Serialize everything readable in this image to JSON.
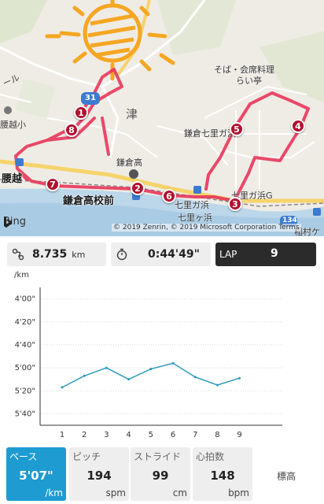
{
  "map": {
    "labels": {
      "sobakaiseki": "そば・会席料理",
      "raitei": "らい亭",
      "tsu": "津",
      "kamakura_high": "鎌倉高",
      "kamakura_shichirigahama": "鎌倉七里ガ浜",
      "shichirigahama_g": "七里ガ浜G",
      "kamakura_koukoumae": "鎌倉高校前",
      "shichirigahama_station": "七里ガ浜",
      "shichirigahama_coast": "七里ヶ浜",
      "inamuragasaki": "稲村ケ",
      "koshigoe": "腰越",
      "koshigoe_school": "腰越小",
      "road_number_31": "31",
      "road_number_134": "134",
      "road_fragment": "ール"
    },
    "markers": [
      "1",
      "8",
      "7",
      "2",
      "6",
      "3",
      "5",
      "4"
    ],
    "attribution": "Bing",
    "copyright": "© 2019 Zenrin, © 2019 Microsoft Corporation  Terms",
    "route_color": "#e8365a",
    "marker_color": "#b0112e",
    "sun_color": "#f5a623"
  },
  "stats": {
    "distance_value": "8.735",
    "distance_unit": "km",
    "duration_value": "0:44'49\"",
    "lap_label": "LAP",
    "lap_value": "9"
  },
  "chart_data": {
    "type": "line",
    "ylabel": "/km",
    "categories": [
      "1",
      "2",
      "3",
      "4",
      "5",
      "6",
      "7",
      "8",
      "9"
    ],
    "y_tick_labels": [
      "4'00\"",
      "4'20\"",
      "4'40\"",
      "5'00\"",
      "5'20\"",
      "5'40\""
    ],
    "y_ticks_seconds": [
      240,
      260,
      280,
      300,
      320,
      340
    ],
    "ylim_seconds": [
      230,
      350
    ],
    "y_inverted": true,
    "series": [
      {
        "values_seconds": [
          317,
          307,
          300,
          310,
          301,
          296,
          308,
          315,
          309
        ]
      }
    ],
    "line_color": "#2b9ab8"
  },
  "tabs": [
    {
      "label": "ペース",
      "value": "5'07\"",
      "unit": "/km"
    },
    {
      "label": "ピッチ",
      "value": "194",
      "unit": "spm"
    },
    {
      "label": "ストライド",
      "value": "99",
      "unit": "cm"
    },
    {
      "label": "心拍数",
      "value": "148",
      "unit": "bpm"
    },
    {
      "label": "標高"
    }
  ],
  "colors": {
    "active_tab": "#1e9bd1",
    "lap_bg": "#2b2b2b"
  }
}
